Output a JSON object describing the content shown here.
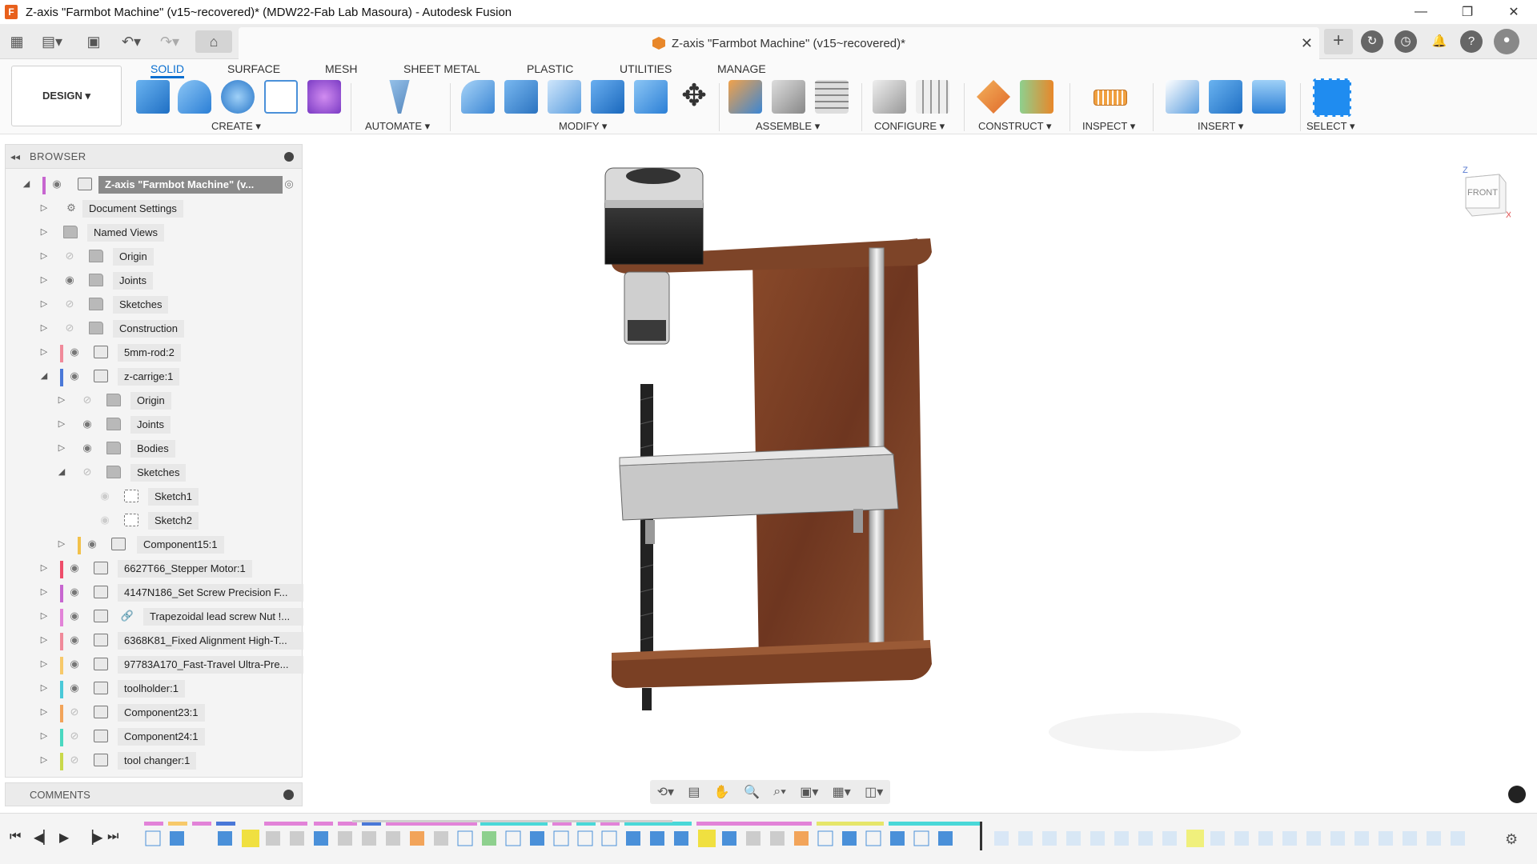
{
  "window": {
    "title": "Z-axis \"Farmbot Machine\" (v15~recovered)* (MDW22-Fab Lab Masoura) - Autodesk Fusion",
    "app_icon_letter": "F",
    "minimize": "—",
    "restore": "❐",
    "close": "✕"
  },
  "quick_access": {
    "tab_title": "Z-axis \"Farmbot Machine\" (v15~recovered)*",
    "tab_close": "✕",
    "add_tab": "+"
  },
  "toolbar": {
    "workspace": "DESIGN ▾",
    "tabs": [
      "SOLID",
      "SURFACE",
      "MESH",
      "SHEET METAL",
      "PLASTIC",
      "UTILITIES",
      "MANAGE"
    ],
    "groups": [
      "CREATE ▾",
      "AUTOMATE ▾",
      "MODIFY ▾",
      "ASSEMBLE ▾",
      "CONFIGURE ▾",
      "CONSTRUCT ▾",
      "INSPECT ▾",
      "INSERT ▾",
      "SELECT ▾"
    ]
  },
  "browser": {
    "title": "BROWSER",
    "root": "Z-axis \"Farmbot Machine\" (v...",
    "items": [
      "Document Settings",
      "Named Views",
      "Origin",
      "Joints",
      "Sketches",
      "Construction",
      "5mm-rod:2",
      "z-carrige:1",
      "Origin",
      "Joints",
      "Bodies",
      "Sketches",
      "Sketch1",
      "Sketch2",
      "Component15:1",
      "6627T66_Stepper Motor:1",
      "4147N186_Set Screw Precision F...",
      "Trapezoidal lead screw Nut !...",
      "6368K81_Fixed Alignment High-T...",
      "97783A170_Fast-Travel Ultra-Pre...",
      "toolholder:1",
      "Component23:1",
      "Component24:1",
      "tool changer:1"
    ]
  },
  "comments": {
    "title": "COMMENTS"
  },
  "viewcube": {
    "face": "FRONT",
    "axis_z": "Z",
    "axis_x": "X"
  },
  "colors": {
    "accent": "#0a6fd0",
    "wood": "#7a3f22",
    "metal": "#d9d9d9"
  }
}
